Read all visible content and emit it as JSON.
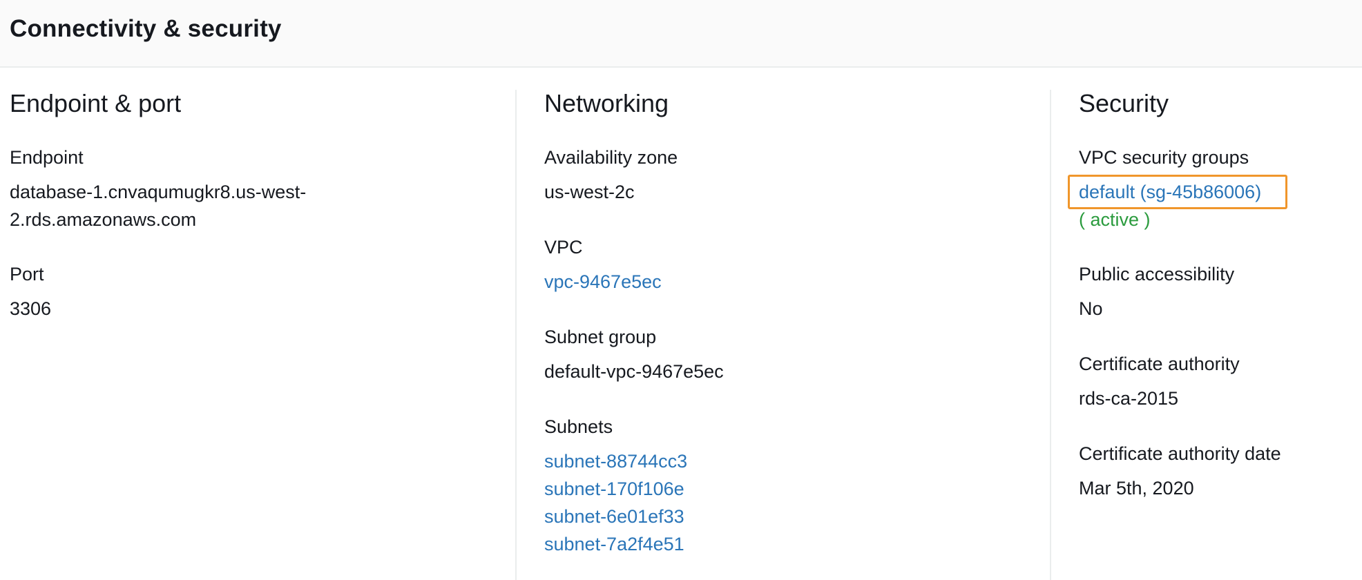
{
  "header": {
    "title": "Connectivity & security"
  },
  "endpoint_port": {
    "title": "Endpoint & port",
    "endpoint_label": "Endpoint",
    "endpoint_value_line1": "database-1.cnvaqumugkr8.us-west-",
    "endpoint_value_line2": "2.rds.amazonaws.com",
    "port_label": "Port",
    "port_value": "3306"
  },
  "networking": {
    "title": "Networking",
    "az_label": "Availability zone",
    "az_value": "us-west-2c",
    "vpc_label": "VPC",
    "vpc_value": "vpc-9467e5ec",
    "subnet_group_label": "Subnet group",
    "subnet_group_value": "default-vpc-9467e5ec",
    "subnets_label": "Subnets",
    "subnets": [
      "subnet-88744cc3",
      "subnet-170f106e",
      "subnet-6e01ef33",
      "subnet-7a2f4e51"
    ]
  },
  "security": {
    "title": "Security",
    "sg_label": "VPC security groups",
    "sg_value": "default (sg-45b86006)",
    "sg_status": "( active )",
    "public_label": "Public accessibility",
    "public_value": "No",
    "ca_label": "Certificate authority",
    "ca_value": "rds-ca-2015",
    "ca_date_label": "Certificate authority date",
    "ca_date_value": "Mar 5th, 2020"
  },
  "colors": {
    "link": "#2a75b8",
    "status_active": "#2b9b3e",
    "highlight_border": "#f0962b"
  }
}
